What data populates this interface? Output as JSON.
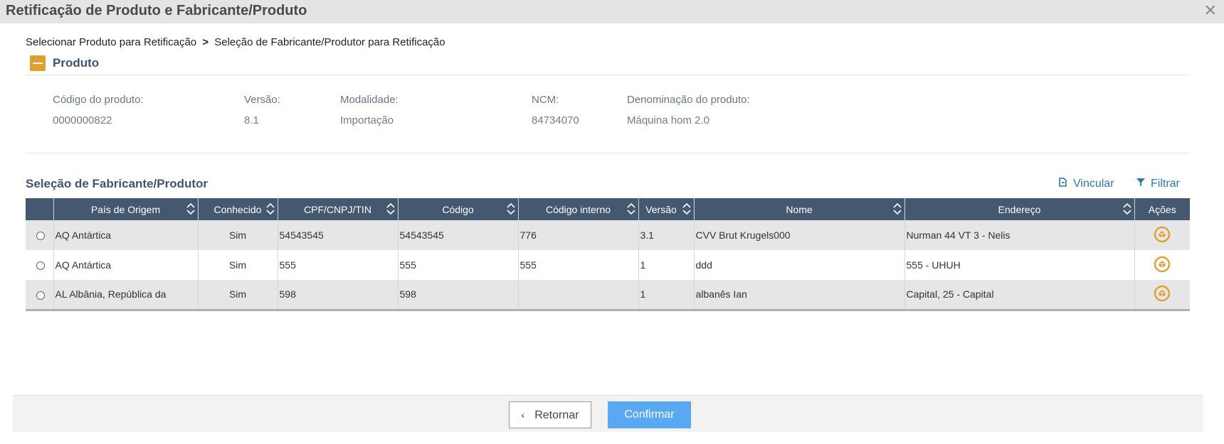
{
  "window": {
    "title": "Retificação de Produto e Fabricante/Produto",
    "close_glyph": "✕"
  },
  "breadcrumb": {
    "step1": "Selecionar Produto para Retificação",
    "separator": ">",
    "step2": "Seleção de Fabricante/Produtor para Retificação"
  },
  "produto": {
    "section_title": "Produto",
    "fields": [
      {
        "label": "Código do produto:",
        "value": "0000000822"
      },
      {
        "label": "Versão:",
        "value": "8.1"
      },
      {
        "label": "Modalidade:",
        "value": "Importação"
      },
      {
        "label": "NCM:",
        "value": "84734070"
      },
      {
        "label": "Denominação do produto:",
        "value": "Máquina hom 2.0"
      }
    ]
  },
  "fabricante": {
    "section_title": "Seleção de Fabricante/Produtor",
    "actions": {
      "vincular": "Vincular",
      "filtrar": "Filtrar",
      "vincular_icon": "link-document-icon",
      "filtrar_icon": "filter-icon"
    },
    "columns": [
      "País de Origem",
      "Conhecido",
      "CPF/CNPJ/TIN",
      "Código",
      "Código interno",
      "Versão",
      "Nome",
      "Endereço",
      "Ações"
    ],
    "rows": [
      {
        "pais": "AQ Antártica",
        "conhecido": "Sim",
        "cpf": "54543545",
        "codigo": "54543545",
        "codigo_interno": "776",
        "versao": "3.1",
        "nome": "CVV Brut Krugels000",
        "endereco": "Nurman 44 VT 3 - Nelis"
      },
      {
        "pais": "AQ Antártica",
        "conhecido": "Sim",
        "cpf": "555",
        "codigo": "555",
        "codigo_interno": "555",
        "versao": "1",
        "nome": "ddd",
        "endereco": "555 - UHUH"
      },
      {
        "pais": "AL Albânia, República da",
        "conhecido": "Sim",
        "cpf": "598",
        "codigo": "598",
        "codigo_interno": "",
        "versao": "1",
        "nome": "albanês Ian",
        "endereco": "Capital, 25 - Capital"
      }
    ]
  },
  "footer": {
    "back_label": "Retornar",
    "confirm_label": "Confirmar"
  },
  "colors": {
    "header_bg": "#44586f",
    "accent_orange": "#e0a030",
    "link_blue": "#2a7ab0",
    "confirm_blue": "#58a8f2"
  }
}
